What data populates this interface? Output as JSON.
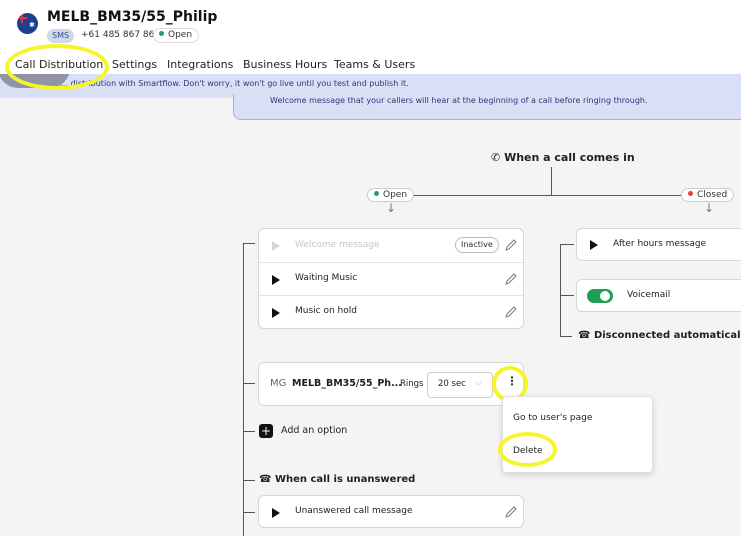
{
  "header": {
    "title": "MELB_BM35/55_Philip",
    "sms_badge": "SMS",
    "phone": "+61 485 867 863",
    "status": "Open",
    "status_color": "#2a9d5c"
  },
  "tabs": [
    "Call Distribution",
    "Settings",
    "Integrations",
    "Business Hours",
    "Teams & Users"
  ],
  "banner": {
    "text": "… distribution with Smartflow. Don't worry, it won't go live until you test and publish it.",
    "welcome_text": "Welcome message that your callers will hear at the beginning of a call before ringing through."
  },
  "flow": {
    "trigger": "When a call comes in",
    "open_label": "Open",
    "closed_label": "Closed",
    "open_color": "#2a9d5c",
    "closed_color": "#e2443a",
    "open_items": [
      {
        "label": "Welcome message",
        "badge": "Inactive"
      },
      {
        "label": "Waiting Music"
      },
      {
        "label": "Music on hold"
      }
    ],
    "closed_items": {
      "after_hours": "After hours message",
      "voicemail": "Voicemail",
      "disconnected": "Disconnected automatically"
    },
    "agent": {
      "initials": "MG",
      "name": "MELB_BM35/55_Ph...",
      "rings_label": "Rings",
      "rings_value": "20 sec"
    },
    "add_option": "Add an option",
    "unanswered_header": "When call is unanswered",
    "unanswered_item": "Unanswered call message"
  },
  "context_menu": {
    "items": [
      "Go to user's page",
      "Delete"
    ]
  },
  "colors": {
    "toggle_on": "#1f9d55",
    "highlight": "#f5f52a"
  }
}
